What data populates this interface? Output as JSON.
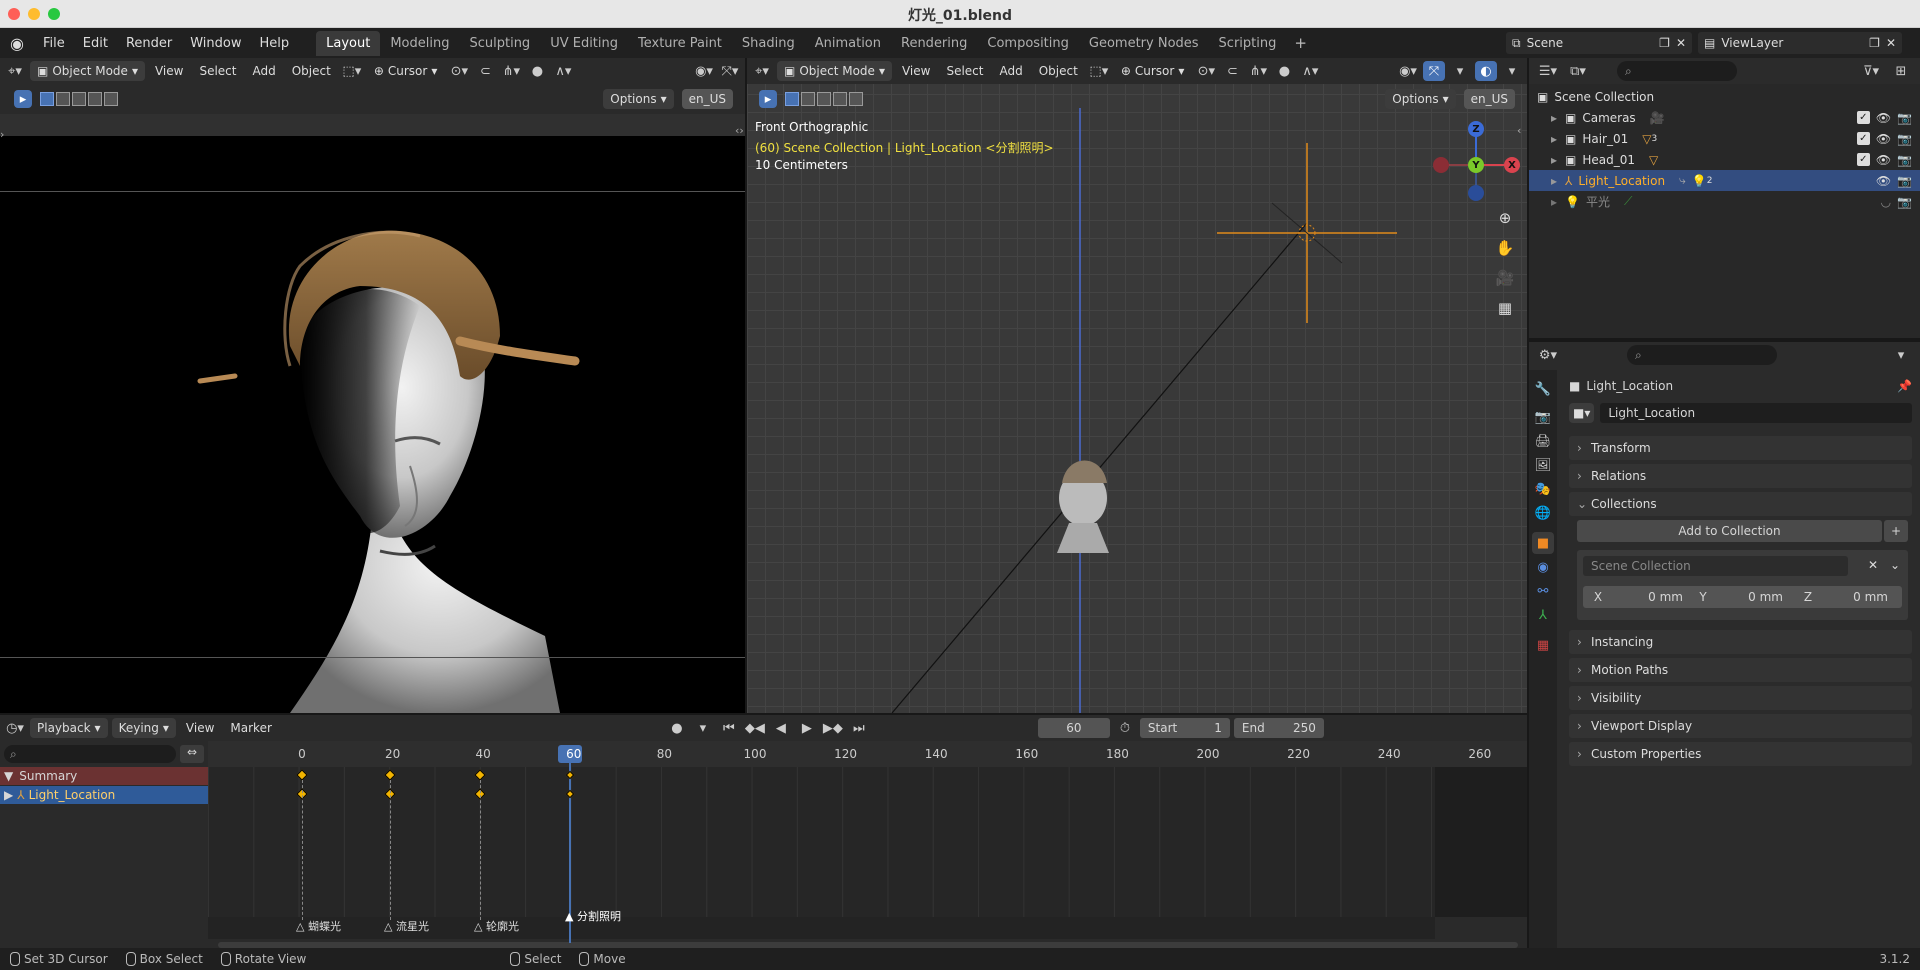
{
  "window": {
    "title": "灯光_01.blend"
  },
  "menu": [
    "File",
    "Edit",
    "Render",
    "Window",
    "Help"
  ],
  "workspaces": [
    "Layout",
    "Modeling",
    "Sculpting",
    "UV Editing",
    "Texture Paint",
    "Shading",
    "Animation",
    "Rendering",
    "Compositing",
    "Geometry Nodes",
    "Scripting"
  ],
  "active_workspace": "Layout",
  "scene": {
    "name": "Scene",
    "view_layer": "ViewLayer"
  },
  "left_view": {
    "mode": "Object Mode",
    "menus": [
      "View",
      "Select",
      "Add",
      "Object"
    ],
    "pivot": "Cursor",
    "options": "Options",
    "lang": "en_US"
  },
  "right_view": {
    "mode": "Object Mode",
    "menus": [
      "View",
      "Select",
      "Add",
      "Object"
    ],
    "pivot": "Cursor",
    "options": "Options",
    "lang": "en_US",
    "view_name": "Front Orthographic",
    "collection_info": "(60) Scene Collection | Light_Location <分割照明>",
    "scale": "10 Centimeters",
    "gizmo": {
      "z": "Z",
      "y": "Y",
      "x": "X"
    }
  },
  "outliner": {
    "root": "Scene Collection",
    "items": [
      {
        "name": "Cameras",
        "badge": ""
      },
      {
        "name": "Hair_01",
        "badge": "3"
      },
      {
        "name": "Head_01",
        "badge": ""
      },
      {
        "name": "Light_Location",
        "badge": "2",
        "selected": true
      },
      {
        "name": "平光",
        "badge": ""
      }
    ]
  },
  "properties": {
    "object_name": "Light_Location",
    "data_name": "Light_Location",
    "panels": [
      "Transform",
      "Relations",
      "Collections",
      "Instancing",
      "Motion Paths",
      "Visibility",
      "Viewport Display",
      "Custom Properties"
    ],
    "add_to_collection": "Add to Collection",
    "collection_field": "Scene Collection",
    "offset": {
      "x_label": "X",
      "x": "0 mm",
      "y_label": "Y",
      "y": "0 mm",
      "z_label": "Z",
      "z": "0 mm"
    }
  },
  "timeline": {
    "menus": [
      "Playback",
      "Keying",
      "View",
      "Marker"
    ],
    "current_frame": "60",
    "start_label": "Start",
    "start": "1",
    "end_label": "End",
    "end": "250",
    "ticks": [
      "0",
      "20",
      "40",
      "60",
      "80",
      "100",
      "120",
      "140",
      "160",
      "180",
      "200",
      "220",
      "240",
      "260"
    ],
    "channels": [
      "Summary",
      "Light_Location"
    ],
    "markers": [
      "蝴蝶光",
      "流星光",
      "轮廓光",
      "分割照明"
    ]
  },
  "status": {
    "items": [
      "Set 3D Cursor",
      "Box Select",
      "Rotate View",
      "Select",
      "Move"
    ],
    "version": "3.1.2"
  }
}
